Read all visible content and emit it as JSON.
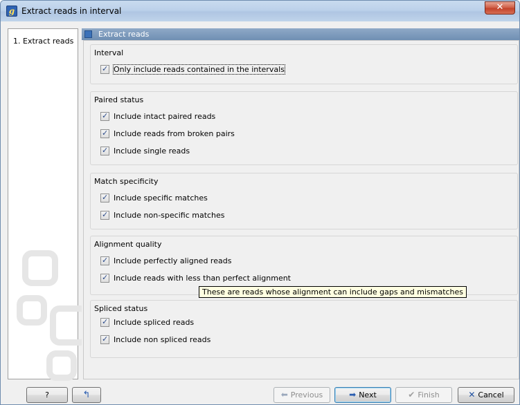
{
  "window": {
    "title": "Extract reads in interval",
    "app_icon_letter": "g",
    "close_symbol": "✕"
  },
  "steps": [
    {
      "label": "1.  Extract reads"
    }
  ],
  "panel": {
    "title": "Extract reads"
  },
  "groups": [
    {
      "title": "Interval",
      "options": [
        {
          "label": "Only include reads contained in the intervals",
          "checked": true
        }
      ]
    },
    {
      "title": "Paired status",
      "options": [
        {
          "label": "Include intact paired reads",
          "checked": true
        },
        {
          "label": "Include reads from broken pairs",
          "checked": true
        },
        {
          "label": "Include single reads",
          "checked": true
        }
      ]
    },
    {
      "title": "Match specificity",
      "options": [
        {
          "label": "Include specific matches",
          "checked": true
        },
        {
          "label": "Include non-specific matches",
          "checked": true
        }
      ]
    },
    {
      "title": "Alignment quality",
      "options": [
        {
          "label": "Include perfectly aligned reads",
          "checked": true
        },
        {
          "label": "Include reads with less than perfect alignment",
          "checked": true
        }
      ]
    },
    {
      "title": "Spliced status",
      "options": [
        {
          "label": "Include spliced reads",
          "checked": true
        },
        {
          "label": "Include non spliced reads",
          "checked": true
        }
      ]
    }
  ],
  "tooltip": "These are reads whose alignment can include gaps and mismatches",
  "footer": {
    "help_label": "?",
    "previous_label": "Previous",
    "next_label": "Next",
    "finish_label": "Finish",
    "cancel_label": "Cancel"
  },
  "icons": {
    "app": "app-logo-icon",
    "close": "close-icon",
    "help": "question-icon",
    "reset": "reset-arrow-icon",
    "previous": "arrow-left-icon",
    "next": "arrow-right-icon",
    "finish": "checkmark-icon",
    "cancel": "x-cancel-icon"
  },
  "colors": {
    "titlebar": "#bcd1ea",
    "panel_header": "#7e9bbd",
    "tooltip_bg": "#ffffe1",
    "close_button": "#c3432b",
    "next_arrow": "#2a5db0",
    "cancel_x": "#1f4f9e"
  }
}
